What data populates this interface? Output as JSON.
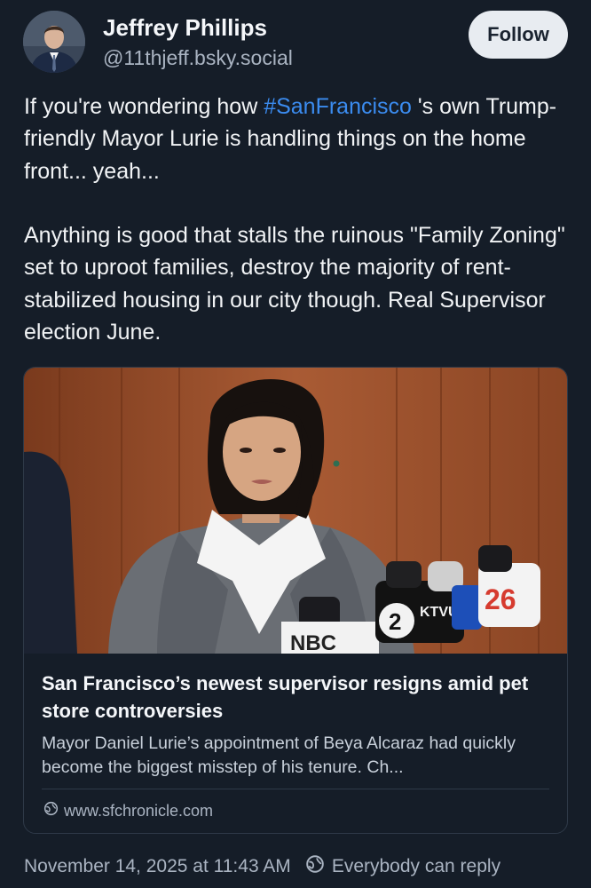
{
  "author": {
    "name": "Jeffrey Phillips",
    "handle": "@11thjeff.bsky.social",
    "avatar_icon": "avatar-photo"
  },
  "follow_button": {
    "label": "Follow"
  },
  "post": {
    "paragraph1": {
      "before": "If you're wondering how ",
      "hashtag": "#SanFrancisco",
      "after": " 's own Trump-friendly Mayor Lurie is handling things on the home front... yeah..."
    },
    "paragraph2": "Anything is good that stalls the ruinous \"Family Zoning\" set to uproot families, destroy the majority of rent-stabilized housing in our city though. Real Supervisor election June."
  },
  "link_card": {
    "title": "San Francisco’s newest supervisor resigns amid pet store controversies",
    "description": "Mayor Daniel Lurie’s appointment of Beya Alcaraz had quickly become the biggest misstep of his tenure. Ch...",
    "domain": "www.sfchronicle.com",
    "domain_icon": "globe-icon",
    "image": {
      "microphone_labels": [
        "NBC",
        "2",
        "KTVU",
        "26"
      ]
    }
  },
  "footer": {
    "timestamp": "November 14, 2025 at 11:43 AM",
    "reply_setting": "Everybody can reply",
    "reply_icon": "globe-icon"
  },
  "colors": {
    "background": "#151d28",
    "hashtag": "#3b8cf0",
    "muted_text": "#aab4c2",
    "follow_button_bg": "#e8ecf1"
  }
}
